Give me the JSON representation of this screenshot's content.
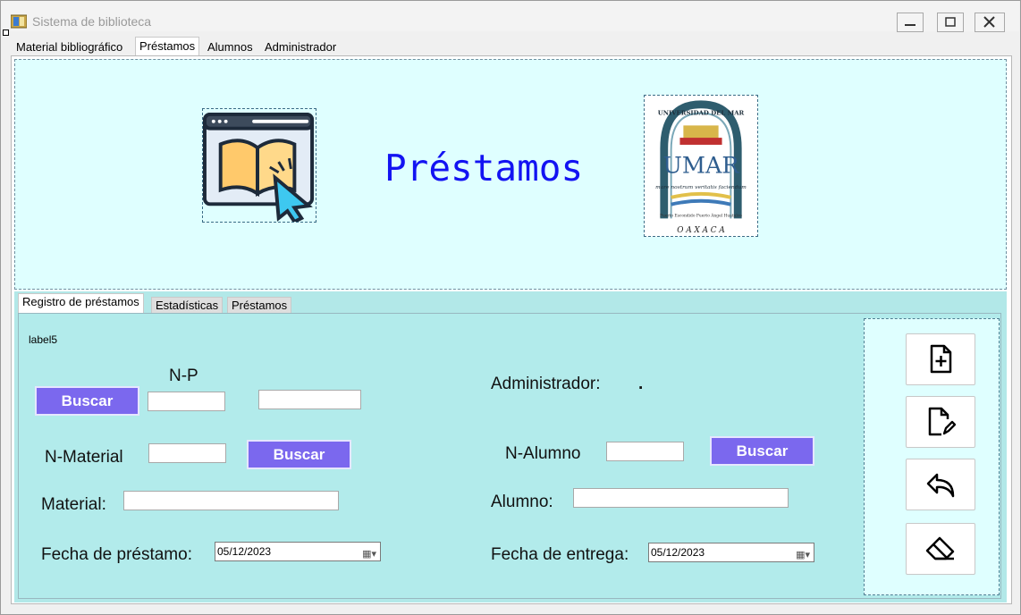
{
  "window": {
    "title": "Sistema de biblioteca"
  },
  "main_tabs": [
    "Material bibliográfico",
    "Préstamos",
    "Alumnos",
    "Administrador"
  ],
  "header": {
    "title": "Préstamos",
    "logo_text_top": "UNIVERSIDAD DEL MAR",
    "logo_monogram": "UMAR",
    "logo_motto": "mare nostrum veritatis faciendum",
    "logo_places": "Puerto Escondido   Puerto Ángel   Huatulco",
    "logo_bottom": "O A X A C A"
  },
  "sub_tabs": [
    "Registro de préstamos",
    "Estadísticas",
    "Préstamos"
  ],
  "form": {
    "label5": "label5",
    "np_label": "N-P",
    "buscar_label": "Buscar",
    "nmaterial_label": "N-Material",
    "material_label": "Material:",
    "fecha_prestamo_label": "Fecha de préstamo:",
    "fecha_prestamo_value": "05/12/2023",
    "administrador_label": "Administrador:",
    "administrador_value": ".",
    "nalumno_label": "N-Alumno",
    "alumno_label": "Alumno:",
    "fecha_entrega_label": "Fecha de entrega:",
    "fecha_entrega_value": "05/12/2023"
  },
  "actions": [
    "new-file-icon",
    "edit-file-icon",
    "back-icon",
    "eraser-icon"
  ],
  "colors": {
    "header_bg": "#dfffff",
    "panel_bg": "#b2ebeb",
    "button_bg": "#7b68ee",
    "title_color": "#1313f2"
  }
}
